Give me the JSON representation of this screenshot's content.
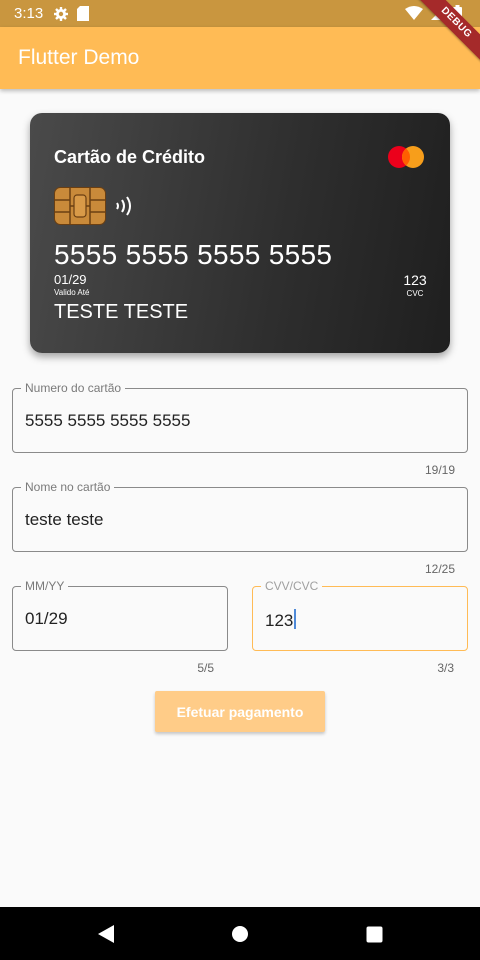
{
  "status_bar": {
    "time": "3:13",
    "icons": [
      "gear-icon",
      "sd-card-icon",
      "wifi-icon",
      "signal-icon",
      "battery-icon"
    ]
  },
  "app_bar": {
    "title": "Flutter Demo",
    "debug_banner": "DEBUG"
  },
  "card": {
    "title": "Cartão de Crédito",
    "number": "5555 5555 5555 5555",
    "expiry": "01/29",
    "expiry_label": "Valido Até",
    "holder": "TESTE TESTE",
    "cvc": "123",
    "cvc_label": "CVC",
    "brand_icon": "mastercard-logo",
    "colors": {
      "bg_start": "#4a4a4a",
      "bg_end": "#1f1f1f"
    }
  },
  "form": {
    "card_number": {
      "label": "Numero do cartão",
      "value": "5555 5555 5555 5555",
      "counter": "19/19"
    },
    "card_name": {
      "label": "Nome no cartão",
      "value": "teste teste",
      "counter": "12/25"
    },
    "expiry": {
      "label": "MM/YY",
      "value": "01/29",
      "counter": "5/5"
    },
    "cvv": {
      "label": "CVV/CVC",
      "value": "123",
      "counter": "3/3"
    }
  },
  "pay_button": {
    "label": "Efetuar pagamento"
  },
  "colors": {
    "accent": "#ffbb55",
    "status_bar": "#c9963f",
    "button_disabled": "#ffcc88"
  },
  "nav_bar": {
    "icons": [
      "back-icon",
      "home-icon",
      "recents-icon"
    ]
  }
}
